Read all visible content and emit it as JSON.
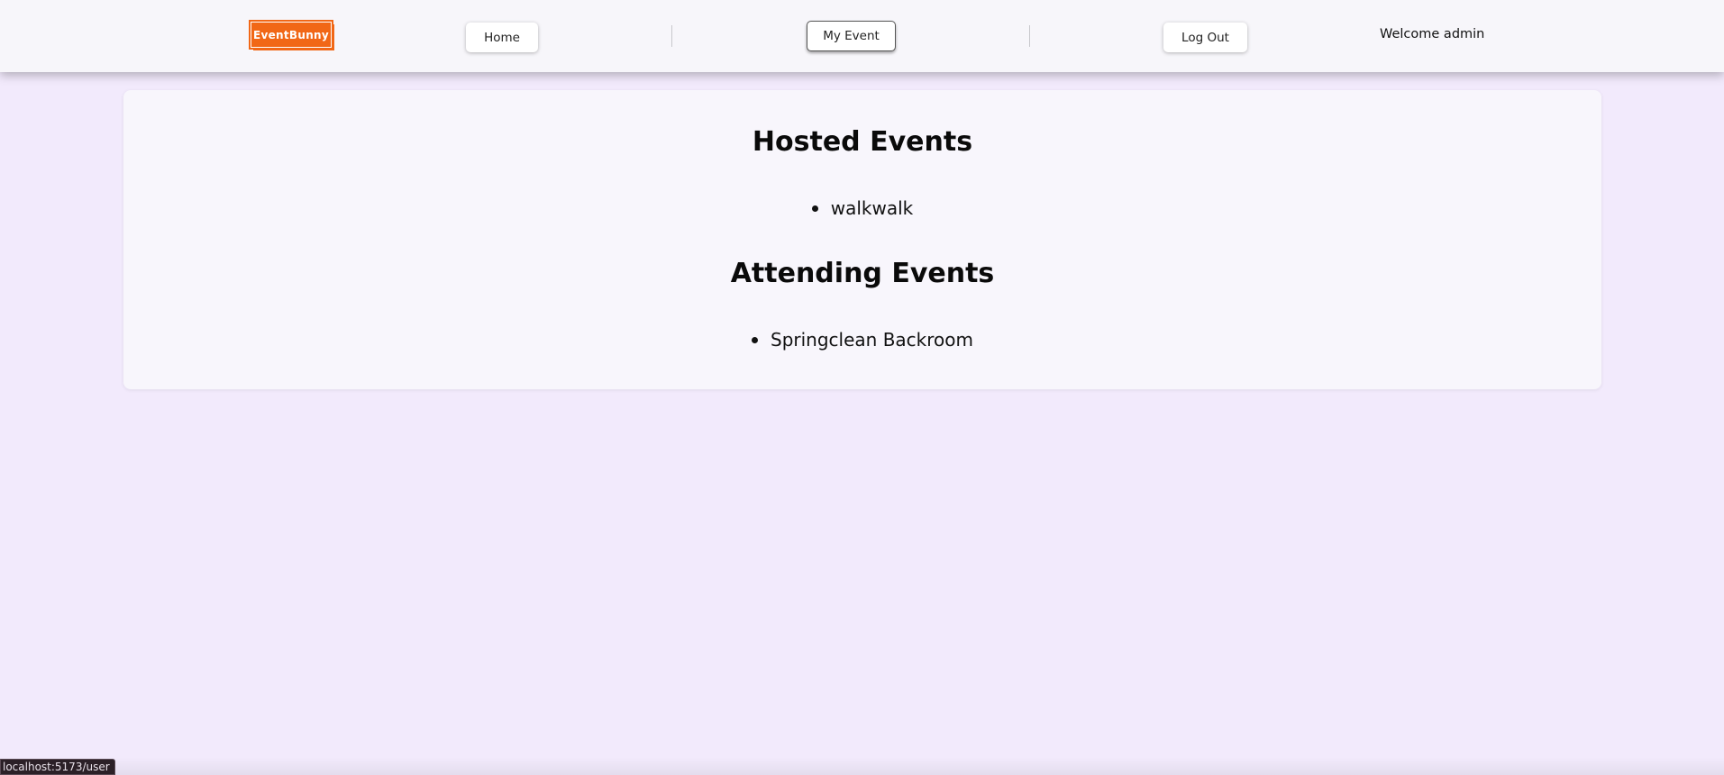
{
  "navbar": {
    "logo_text": "EventBunny",
    "home_label": "Home",
    "my_event_label": "My Event",
    "logout_label": "Log Out",
    "welcome_text": "Welcome admin"
  },
  "main": {
    "hosted_title": "Hosted Events",
    "hosted_events": [
      "walkwalk"
    ],
    "attending_title": "Attending Events",
    "attending_events": [
      "Springclean Backroom"
    ]
  },
  "status_bar": {
    "link_url": "localhost:5173/user"
  },
  "colors": {
    "brand": "#f16716",
    "background": "#f2eafc",
    "card": "#f8f6fc"
  }
}
